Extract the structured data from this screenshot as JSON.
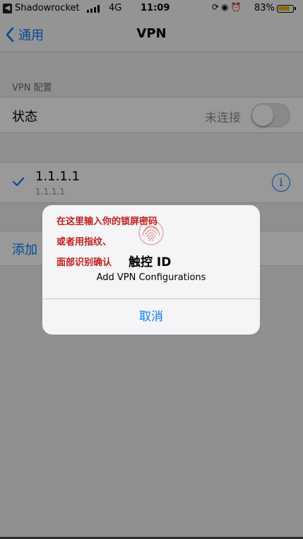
{
  "status_bar": {
    "back_app": "Shadowrocket",
    "network": "4G",
    "time": "11:09",
    "battery_percent": "83%",
    "battery_level": 0.83,
    "battery_color": "#e9b11a",
    "icons": [
      "signal-icon",
      "rotation-lock-icon",
      "location-icon",
      "alarm-icon",
      "battery-icon"
    ]
  },
  "nav": {
    "back_label": "通用",
    "title": "VPN"
  },
  "section": {
    "label": "VPN 配置"
  },
  "status_row": {
    "label": "状态",
    "value": "未连接",
    "toggle_on": false
  },
  "vpn_row": {
    "name": "1.1.1.1",
    "subtitle": "1.1.1.1",
    "selected": true
  },
  "add_row": {
    "label": "添加"
  },
  "alert": {
    "annotation_line_1": "在这里输入你的锁屏密码",
    "annotation_line_2": "或者用指纹、",
    "annotation_line_3": "面部识别确认",
    "title": "触控 ID",
    "message": "Add VPN Configurations",
    "cancel_label": "取消"
  },
  "colors": {
    "accent": "#0a7aff",
    "annotation": "#c41e1e",
    "background": "#efeff4"
  }
}
